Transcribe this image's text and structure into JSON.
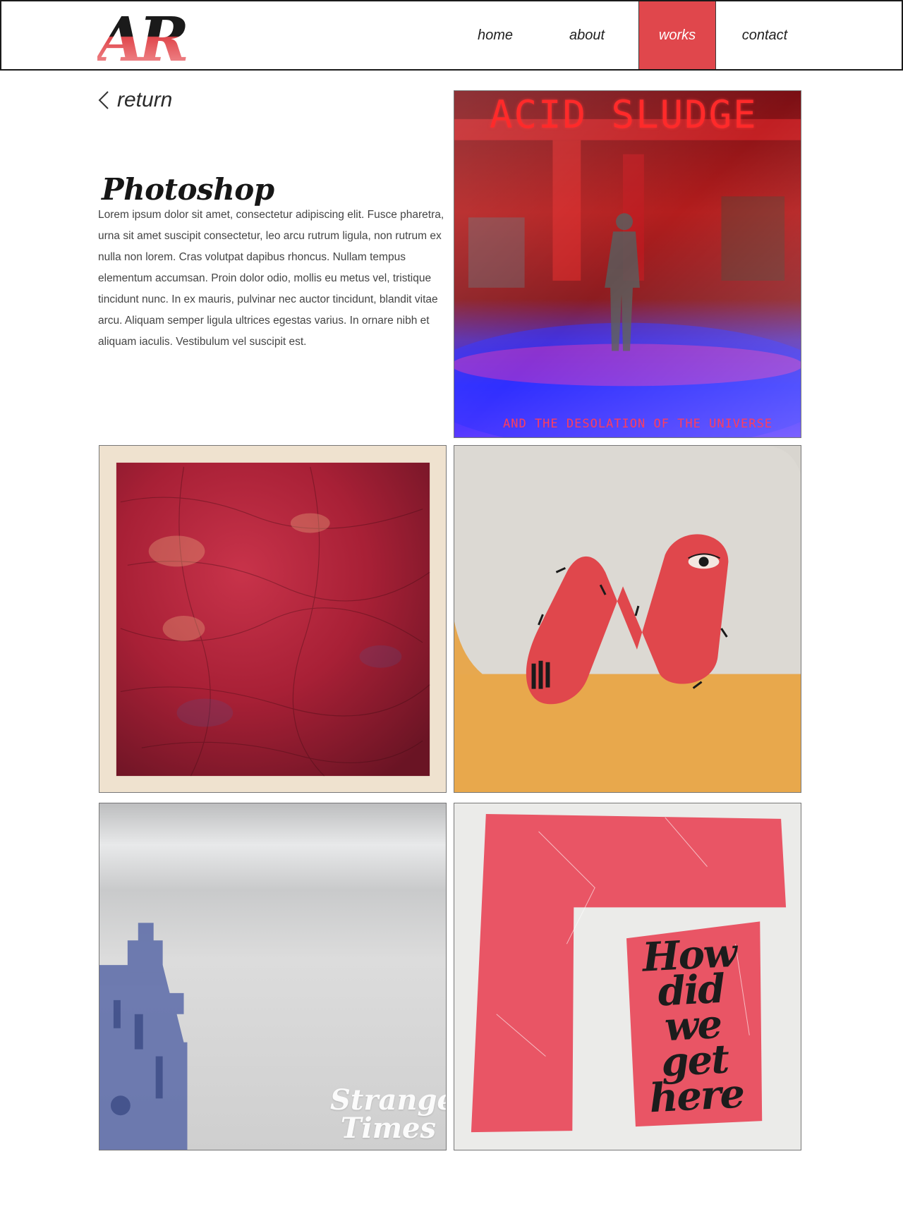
{
  "brand": {
    "logo_text": "AR",
    "accent_color": "#e0474c"
  },
  "nav": {
    "items": [
      {
        "label": "home"
      },
      {
        "label": "about"
      },
      {
        "label": "works",
        "active": true
      },
      {
        "label": "contact"
      }
    ]
  },
  "page": {
    "return_label": "return",
    "title": "Photoshop",
    "description": "Lorem ipsum dolor sit amet, consectetur adipiscing elit. Fusce pharetra, urna sit amet suscipit consectetur, leo arcu rutrum ligula, non rutrum ex nulla non lorem. Cras volutpat dapibus rhoncus. Nullam tempus elementum accumsan. Proin dolor odio, mollis eu metus vel, tristique tincidunt nunc. In ex mauris, pulvinar nec auctor tincidunt, blandit vitae arcu. Aliquam semper ligula ultrices egestas varius. In ornare nibh et aliquam iaculis. Vestibulum vel suscipit est."
  },
  "works": [
    {
      "title": "ACID SLUDGE",
      "subtitle": "AND THE DESOLATION OF THE UNIVERSE"
    },
    {
      "title": ""
    },
    {
      "title": ""
    },
    {
      "title": "Strange Times"
    },
    {
      "title": "How did we get here"
    }
  ]
}
